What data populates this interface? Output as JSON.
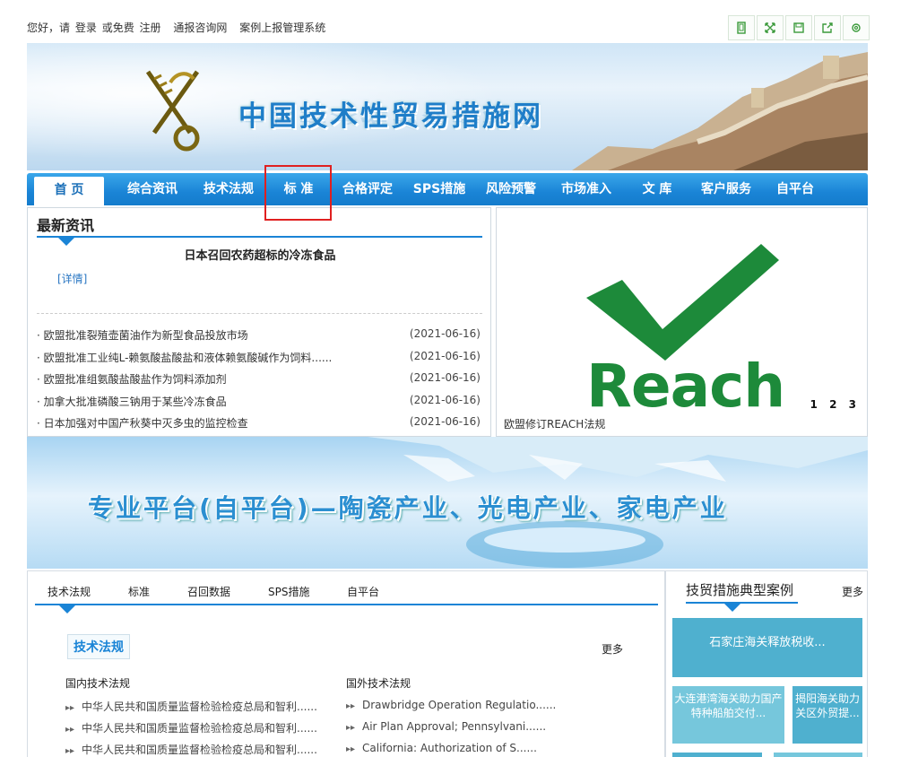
{
  "topbar": {
    "greeting": "您好，请",
    "login": "登录",
    "or_free": "或免费",
    "register": "注册",
    "notify_consult": "通报咨询网",
    "case_system": "案例上报管理系统"
  },
  "banner": {
    "title": "中国技术性贸易措施网"
  },
  "nav": {
    "items": [
      "首 页",
      "综合资讯",
      "技术法规",
      "标 准",
      "合格评定",
      "SPS措施",
      "风险预警",
      "市场准入",
      "文 库",
      "客户服务",
      "自平台"
    ]
  },
  "news": {
    "heading": "最新资讯",
    "headline": "日本召回农药超标的冷冻食品",
    "detail": "[详情]",
    "items": [
      {
        "title": "· 欧盟批准裂殖壶菌油作为新型食品投放市场",
        "date": "(2021-06-16)"
      },
      {
        "title": "· 欧盟批准工业纯L-赖氨酸盐酸盐和液体赖氨酸碱作为饲料......",
        "date": "(2021-06-16)"
      },
      {
        "title": "· 欧盟批准组氨酸盐酸盐作为饲料添加剂",
        "date": "(2021-06-16)"
      },
      {
        "title": "· 加拿大批准磷酸三钠用于某些冷冻食品",
        "date": "(2021-06-16)"
      },
      {
        "title": "· 日本加强对中国产秋葵中灭多虫的监控检查",
        "date": "(2021-06-16)"
      }
    ]
  },
  "reach": {
    "logo_text": "Reach",
    "caption": "欧盟修订REACH法规",
    "pages": [
      "1",
      "2",
      "3"
    ]
  },
  "mid_banner": {
    "slogan": "专业平台(自平台)—陶瓷产业、光电产业、家电产业"
  },
  "tabs": {
    "items": [
      "技术法规",
      "标准",
      "召回数据",
      "SPS措施",
      "自平台"
    ],
    "active_title": "技术法规",
    "more": "更多",
    "domestic": {
      "heading": "国内技术法规",
      "items": [
        "中华人民共和国质量监督检验检疫总局和智利......",
        "中华人民共和国质量监督检验检疫总局和智利......",
        "中华人民共和国质量监督检验检疫总局和智利......"
      ]
    },
    "foreign": {
      "heading": "国外技术法规",
      "items": [
        "Drawbridge Operation Regulatio......",
        "Air Plan Approval; Pennsylvani......",
        "California: Authorization of S......"
      ]
    }
  },
  "cases": {
    "heading": "技贸措施典型案例",
    "more": "更多",
    "main": "石家庄海关释放税收...",
    "a": "大连港湾海关助力国产特种船舶交付...",
    "b": "揭阳海关助力关区外贸提..."
  },
  "colors": {
    "nav_blue": "#1a84d6",
    "highlight_red": "#e02020",
    "reach_green": "#1d8a3a",
    "case_teal": "#4fb0cf"
  }
}
